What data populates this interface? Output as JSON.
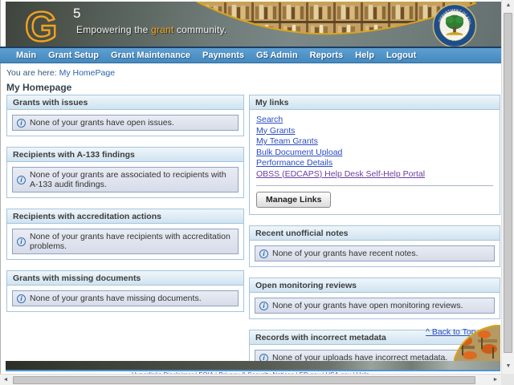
{
  "banner": {
    "logo_g": "G",
    "logo_5": "5",
    "tagline_prefix": "Empowering the ",
    "tagline_highlight": "grant",
    "tagline_suffix": " community.",
    "seal_top_text": "DEPARTMENT OF EDUCATION",
    "seal_bottom_text": "UNITED STATES OF AMERICA"
  },
  "nav": {
    "items": [
      "Main",
      "Grant Setup",
      "Grant Maintenance",
      "Payments",
      "G5 Admin",
      "Reports",
      "Help",
      "Logout"
    ]
  },
  "breadcrumb": {
    "prefix": "You are here:",
    "current": "My HomePage"
  },
  "page": {
    "title": "My Homepage"
  },
  "icons": {
    "info": "i",
    "up_arrow": "▲",
    "down_arrow": "▼",
    "left_arrow": "◄",
    "right_arrow": "►"
  },
  "left_panels": [
    {
      "title": "Grants with issues",
      "message": "None of your grants have open issues."
    },
    {
      "title": "Recipients with A-133 findings",
      "message": "None of your grants are associated to recipients with A-133 audit findings."
    },
    {
      "title": "Recipients with accreditation actions",
      "message": "None of your grants have recipients with accreditation problems."
    },
    {
      "title": "Grants with missing documents",
      "message": "None of your grants have missing documents."
    }
  ],
  "my_links": {
    "title": "My links",
    "links": [
      "Search",
      "My Grants",
      "My Team Grants",
      "Bulk Document Upload",
      "Performance Details",
      "OBSS (EDCAPS) Help Desk Self-Help Portal"
    ],
    "manage_button": "Manage Links"
  },
  "right_panels": [
    {
      "title": "Recent unofficial notes",
      "message": "None of your grants have recent notes."
    },
    {
      "title": "Open monitoring reviews",
      "message": "None of your grants have open monitoring reviews."
    },
    {
      "title": "Records with incorrect metadata",
      "message": "None of your uploads have incorrect metadata."
    }
  ],
  "back_to_top": "^ Back to Top",
  "footer": {
    "links": [
      "Hyperlinks Disclaimer",
      "FOIA",
      "Privacy & Security Notices",
      "ED.gov",
      "USA.gov",
      "Help"
    ],
    "separator": "|"
  },
  "colors": {
    "nav_blue": "#4589bd",
    "panel_border": "#a6c4dc",
    "link_blue": "#2a4cc2",
    "visited_link_purple": "#6b3fa0",
    "logo_orange": "#f5a21d",
    "footer_line_blue": "#4f94d0"
  }
}
